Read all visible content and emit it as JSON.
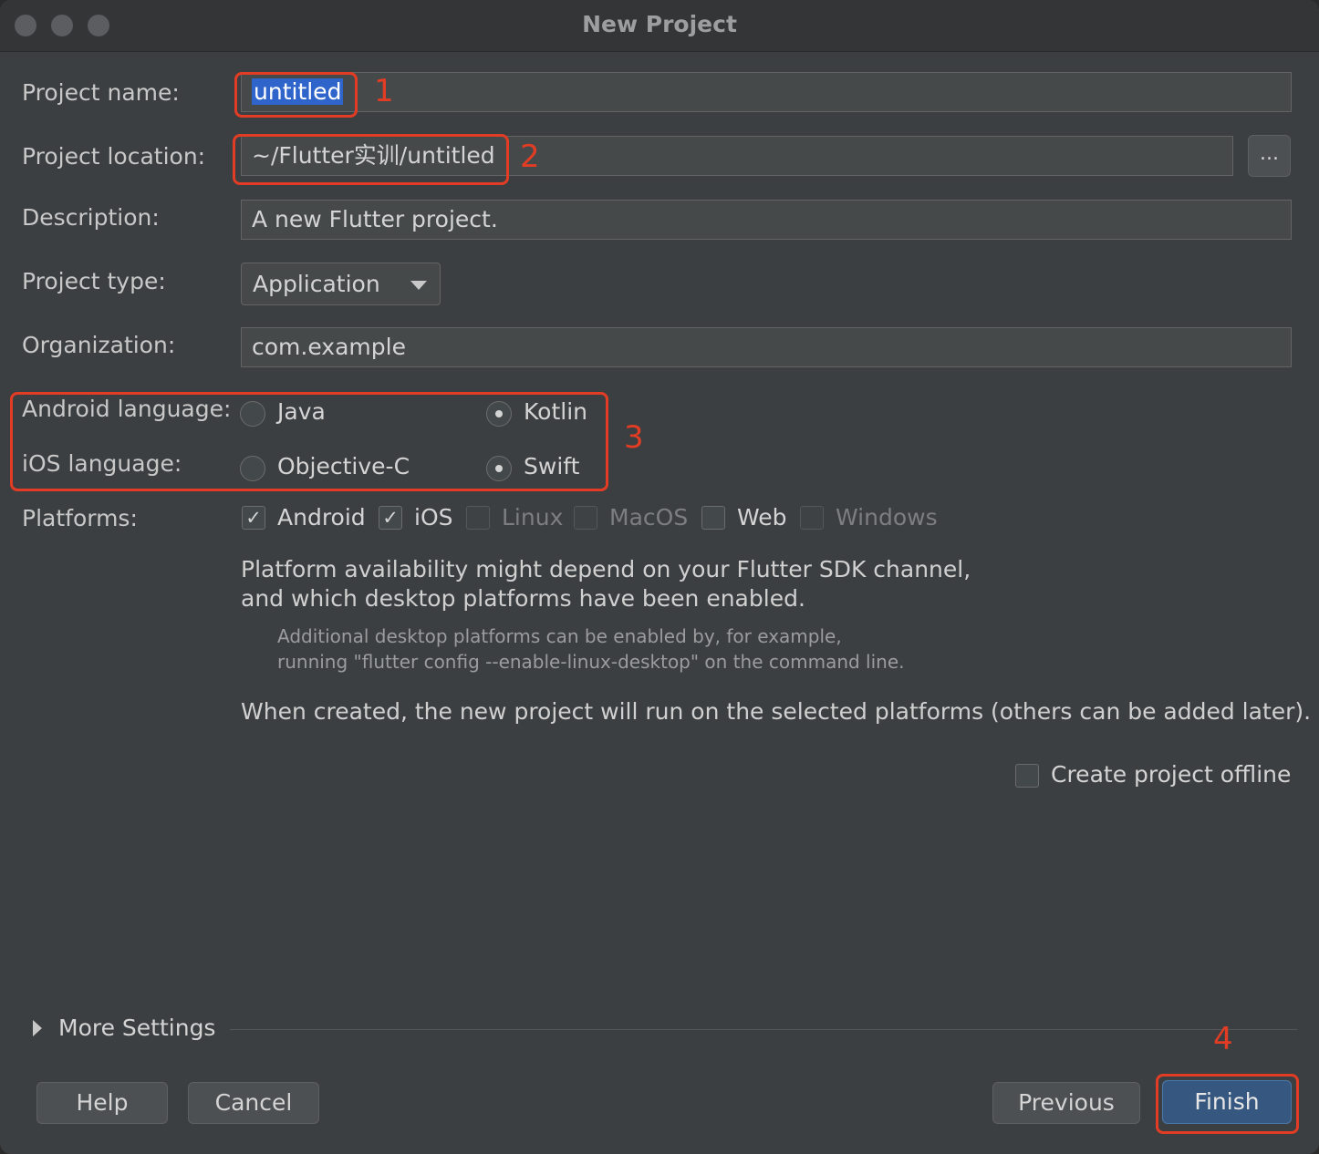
{
  "window": {
    "title": "New Project"
  },
  "form": {
    "project_name": {
      "label": "Project name:",
      "value": "untitled"
    },
    "project_location": {
      "label": "Project location:",
      "value": "~/Flutter实训/untitled",
      "browse_label": "..."
    },
    "description": {
      "label": "Description:",
      "value": "A new Flutter project."
    },
    "project_type": {
      "label": "Project type:",
      "value": "Application"
    },
    "organization": {
      "label": "Organization:",
      "value": "com.example"
    },
    "android_language": {
      "label": "Android language:",
      "options": [
        "Java",
        "Kotlin"
      ],
      "selected": "Kotlin"
    },
    "ios_language": {
      "label": "iOS language:",
      "options": [
        "Objective-C",
        "Swift"
      ],
      "selected": "Swift"
    },
    "platforms": {
      "label": "Platforms:",
      "items": [
        {
          "label": "Android",
          "checked": true,
          "enabled": true
        },
        {
          "label": "iOS",
          "checked": true,
          "enabled": true
        },
        {
          "label": "Linux",
          "checked": false,
          "enabled": false
        },
        {
          "label": "MacOS",
          "checked": false,
          "enabled": false
        },
        {
          "label": "Web",
          "checked": false,
          "enabled": true
        },
        {
          "label": "Windows",
          "checked": false,
          "enabled": false
        }
      ]
    },
    "platform_note_1": "Platform availability might depend on your Flutter SDK channel,",
    "platform_note_2": "and which desktop platforms have been enabled.",
    "platform_hint_1": "Additional desktop platforms can be enabled by, for example,",
    "platform_hint_2": "running \"flutter config --enable-linux-desktop\" on the command line.",
    "created_note": "When created, the new project will run on the selected platforms (others can be added later).",
    "offline": {
      "label": "Create project offline",
      "checked": false
    },
    "more_settings": "More Settings"
  },
  "buttons": {
    "help": "Help",
    "cancel": "Cancel",
    "previous": "Previous",
    "finish": "Finish"
  },
  "annotations": [
    "1",
    "2",
    "3",
    "4"
  ],
  "colors": {
    "annotation": "#e23d24",
    "selection": "#2f65ca",
    "primary_button": "#365880"
  }
}
